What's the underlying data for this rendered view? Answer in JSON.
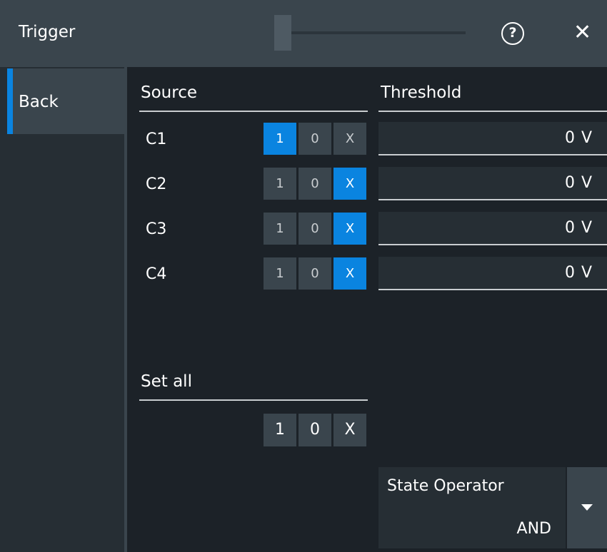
{
  "header": {
    "title": "Trigger",
    "help_icon": "?",
    "close_icon": "✕"
  },
  "sidebar": {
    "back_label": "Back"
  },
  "source": {
    "heading": "Source",
    "rows": [
      {
        "label": "C1",
        "options": [
          "1",
          "0",
          "X"
        ],
        "selected": "1"
      },
      {
        "label": "C2",
        "options": [
          "1",
          "0",
          "X"
        ],
        "selected": "X"
      },
      {
        "label": "C3",
        "options": [
          "1",
          "0",
          "X"
        ],
        "selected": "X"
      },
      {
        "label": "C4",
        "options": [
          "1",
          "0",
          "X"
        ],
        "selected": "X"
      }
    ]
  },
  "threshold": {
    "heading": "Threshold",
    "values": [
      "0 V",
      "0 V",
      "0 V",
      "0 V"
    ]
  },
  "set_all": {
    "heading": "Set all",
    "options": [
      "1",
      "0",
      "X"
    ]
  },
  "state_operator": {
    "label": "State Operator",
    "value": "AND"
  },
  "colors": {
    "accent": "#0a84e0",
    "background": "#1c2228",
    "panel": "#262e34",
    "button": "#3a454d"
  },
  "icons": {
    "help": "question-circle-icon",
    "close": "close-icon",
    "dropdown": "triangle-down-icon"
  }
}
